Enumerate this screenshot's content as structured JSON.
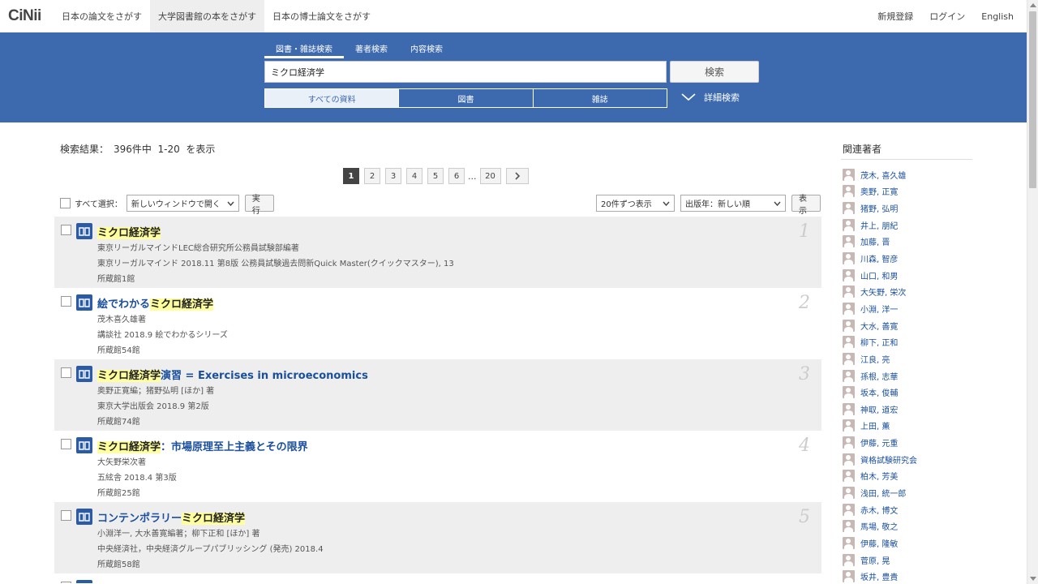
{
  "nav": {
    "logo": "CiNii",
    "links": [
      "日本の論文をさがす",
      "大学図書館の本をさがす",
      "日本の博士論文をさがす"
    ],
    "right": [
      "新規登録",
      "ログイン",
      "English"
    ]
  },
  "search": {
    "tabs": [
      "図書・雑誌検索",
      "著者検索",
      "内容検索"
    ],
    "query": "ミクロ経済学",
    "button": "検索",
    "material_tabs": [
      "すべての資料",
      "図書",
      "雑誌"
    ],
    "advanced": "詳細検索"
  },
  "summary": "検索結果：　396件中  1-20  を表示",
  "pagination": {
    "pages": [
      "1",
      "2",
      "3",
      "4",
      "5",
      "6"
    ],
    "ellipsis": "...",
    "last": "20"
  },
  "controls": {
    "select_all": "すべて選択：",
    "open_option": "新しいウィンドウで開く",
    "execute": "実行",
    "per_page": "20件ずつ表示",
    "sort": "出版年：新しい順",
    "show": "表示"
  },
  "results": [
    {
      "num": "1",
      "title_hl": "ミクロ経済学",
      "title_rest": "",
      "author": "東京リーガルマインドLEC総合研究所公務員試験部編著",
      "pub": "東京リーガルマインド 2018.11 第8版 公務員試験過去問新Quick Master(クイックマスター), 13",
      "holdings": "所蔵館1館"
    },
    {
      "num": "2",
      "title_pre": "絵でわかる",
      "title_hl": "ミクロ経済学",
      "title_rest": "",
      "author": "茂木喜久雄著",
      "pub": "講談社 2018.9 絵でわかるシリーズ",
      "holdings": "所蔵館54館"
    },
    {
      "num": "3",
      "title_hl": "ミクロ経済学",
      "title_rest": "演習 = Exercises in microeconomics",
      "author": "奥野正寛編；猪野弘明 [ほか] 著",
      "pub": "東京大学出版会 2018.9 第2版",
      "holdings": "所蔵館74館"
    },
    {
      "num": "4",
      "title_hl": "ミクロ経済学",
      "title_rest": "：市場原理至上主義とその限界",
      "author": "大矢野栄次著",
      "pub": "五絃舎 2018.4 第3版",
      "holdings": "所蔵館25館"
    },
    {
      "num": "5",
      "title_pre": "コンテンポラリー",
      "title_hl": "ミクロ経済学",
      "title_rest": "",
      "author": "小淵洋一, 大水善寛編著；柳下正和 [ほか] 著",
      "pub": "中央経済社，中央経済グループパブリッシング (発売) 2018.4",
      "holdings": "所蔵館58館"
    }
  ],
  "sidebar": {
    "title": "関連著者",
    "authors": [
      "茂木, 喜久雄",
      "奥野, 正寛",
      "猪野, 弘明",
      "井上, 朋紀",
      "加藤, 晋",
      "川森, 智彦",
      "山口, 和男",
      "大矢野, 栄次",
      "小淵, 洋一",
      "大水, 善寛",
      "柳下, 正和",
      "江良, 亮",
      "孫根, 志華",
      "坂本, 俊輔",
      "神取, 道宏",
      "上田, 薫",
      "伊藤, 元重",
      "資格試験研究会",
      "柏木, 芳美",
      "浅田, 統一郎",
      "赤木, 博文",
      "馬場, 敬之",
      "伊藤, 隆敏",
      "菅原, 晃",
      "坂井, 豊貴"
    ]
  },
  "colors": {
    "band": "#3d6aaf",
    "link": "#1a4f9c",
    "highlight": "#ffff9d"
  }
}
